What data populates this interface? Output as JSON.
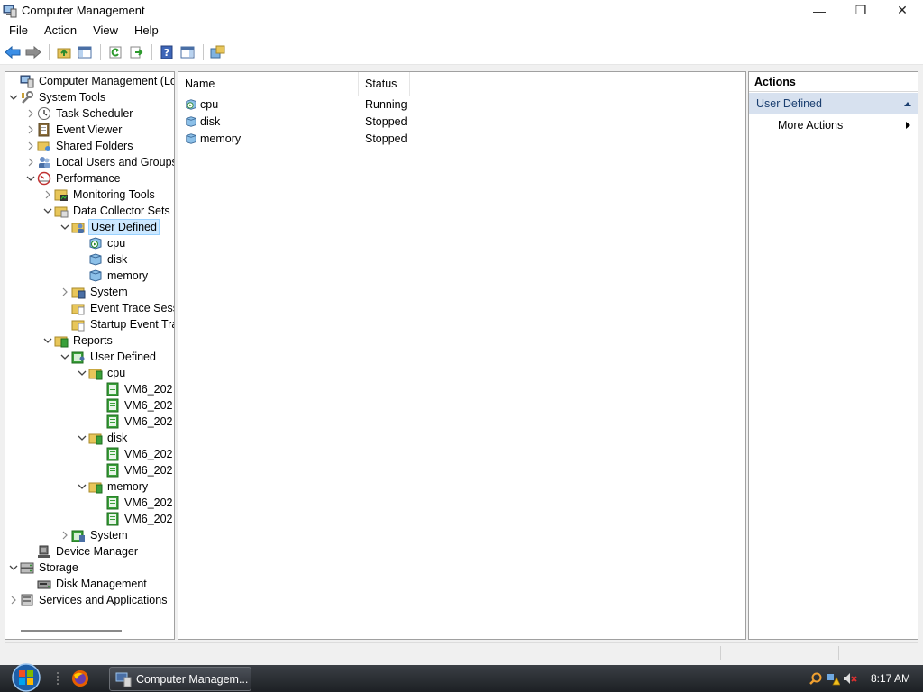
{
  "window": {
    "title": "Computer Management",
    "minimize_glyph": "—",
    "maximize_glyph": "❐",
    "close_glyph": "✕"
  },
  "menu": [
    "File",
    "Action",
    "View",
    "Help"
  ],
  "toolbar": [
    "back-icon",
    "forward-icon",
    "up-folder-icon",
    "show-hide-tree-icon",
    "refresh-icon",
    "export-list-icon",
    "help-icon",
    "show-hide-action-pane-icon",
    "properties-icon"
  ],
  "tree": [
    {
      "label": "Computer Management (Local",
      "depth": 0,
      "exp": "",
      "icon": "computer-management-icon"
    },
    {
      "label": "System Tools",
      "depth": 0,
      "exp": "v",
      "icon": "system-tools-icon"
    },
    {
      "label": "Task Scheduler",
      "depth": 1,
      "exp": ">",
      "icon": "task-scheduler-icon"
    },
    {
      "label": "Event Viewer",
      "depth": 1,
      "exp": ">",
      "icon": "event-viewer-icon"
    },
    {
      "label": "Shared Folders",
      "depth": 1,
      "exp": ">",
      "icon": "shared-folders-icon"
    },
    {
      "label": "Local Users and Groups",
      "depth": 1,
      "exp": ">",
      "icon": "users-icon"
    },
    {
      "label": "Performance",
      "depth": 1,
      "exp": "v",
      "icon": "performance-icon"
    },
    {
      "label": "Monitoring Tools",
      "depth": 2,
      "exp": ">",
      "icon": "monitoring-tools-icon"
    },
    {
      "label": "Data Collector Sets",
      "depth": 2,
      "exp": "v",
      "icon": "data-collector-sets-icon"
    },
    {
      "label": "User Defined",
      "depth": 3,
      "exp": "v",
      "icon": "user-defined-icon",
      "selected": true
    },
    {
      "label": "cpu",
      "depth": 4,
      "exp": "",
      "icon": "running-collector-icon"
    },
    {
      "label": "disk",
      "depth": 4,
      "exp": "",
      "icon": "collector-icon"
    },
    {
      "label": "memory",
      "depth": 4,
      "exp": "",
      "icon": "collector-icon"
    },
    {
      "label": "System",
      "depth": 3,
      "exp": ">",
      "icon": "system-folder-icon"
    },
    {
      "label": "Event Trace Sess",
      "depth": 3,
      "exp": "",
      "icon": "trace-folder-icon"
    },
    {
      "label": "Startup Event Tra",
      "depth": 3,
      "exp": "",
      "icon": "trace-folder-icon"
    },
    {
      "label": "Reports",
      "depth": 2,
      "exp": "v",
      "icon": "reports-icon"
    },
    {
      "label": "User Defined",
      "depth": 3,
      "exp": "v",
      "icon": "report-user-defined-icon"
    },
    {
      "label": "cpu",
      "depth": 4,
      "exp": "v",
      "icon": "report-folder-icon"
    },
    {
      "label": "VM6_202",
      "depth": 5,
      "exp": "",
      "icon": "report-icon"
    },
    {
      "label": "VM6_202",
      "depth": 5,
      "exp": "",
      "icon": "report-icon"
    },
    {
      "label": "VM6_202",
      "depth": 5,
      "exp": "",
      "icon": "report-icon"
    },
    {
      "label": "disk",
      "depth": 4,
      "exp": "v",
      "icon": "report-folder-icon"
    },
    {
      "label": "VM6_202",
      "depth": 5,
      "exp": "",
      "icon": "report-icon"
    },
    {
      "label": "VM6_202",
      "depth": 5,
      "exp": "",
      "icon": "report-icon"
    },
    {
      "label": "memory",
      "depth": 4,
      "exp": "v",
      "icon": "report-folder-icon"
    },
    {
      "label": "VM6_202",
      "depth": 5,
      "exp": "",
      "icon": "report-icon"
    },
    {
      "label": "VM6_202",
      "depth": 5,
      "exp": "",
      "icon": "report-icon"
    },
    {
      "label": "System",
      "depth": 3,
      "exp": ">",
      "icon": "report-system-icon"
    },
    {
      "label": "Device Manager",
      "depth": 1,
      "exp": "",
      "icon": "device-manager-icon"
    },
    {
      "label": "Storage",
      "depth": 0,
      "exp": "v",
      "icon": "storage-icon"
    },
    {
      "label": "Disk Management",
      "depth": 1,
      "exp": "",
      "icon": "disk-management-icon"
    },
    {
      "label": "Services and Applications",
      "depth": 0,
      "exp": ">",
      "icon": "services-icon"
    }
  ],
  "list": {
    "columns": [
      "Name",
      "Status"
    ],
    "rows": [
      {
        "name": "cpu",
        "status": "Running",
        "icon": "running-collector-icon"
      },
      {
        "name": "disk",
        "status": "Stopped",
        "icon": "collector-icon"
      },
      {
        "name": "memory",
        "status": "Stopped",
        "icon": "collector-icon"
      }
    ]
  },
  "actions": {
    "title": "Actions",
    "section": "User Defined",
    "items": [
      "More Actions"
    ]
  },
  "taskbar": {
    "task_label": "Computer Managem...",
    "clock": "8:17 AM"
  }
}
